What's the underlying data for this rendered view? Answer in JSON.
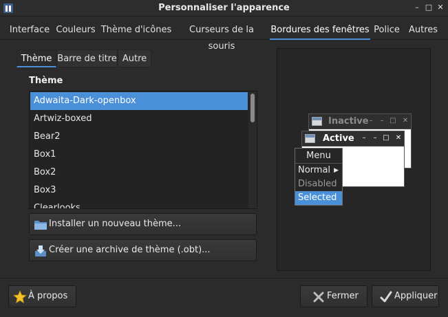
{
  "window": {
    "title": "Personnaliser l'apparence",
    "controls": [
      "minimize",
      "maximize",
      "close"
    ]
  },
  "tabs": [
    {
      "label": "Interface",
      "active": false
    },
    {
      "label": "Couleurs",
      "active": false
    },
    {
      "label": "Thème d'icônes",
      "active": false
    },
    {
      "label": "Curseurs de la souris",
      "active": false
    },
    {
      "label": "Bordures des fenêtres",
      "active": true
    },
    {
      "label": "Police",
      "active": false
    },
    {
      "label": "Autres",
      "active": false
    }
  ],
  "subtabs": [
    {
      "label": "Thème",
      "active": true
    },
    {
      "label": "Barre de titre",
      "active": false
    },
    {
      "label": "Autre",
      "active": false
    }
  ],
  "theme_section": {
    "label": "Thème",
    "items": [
      "Adwaita-Dark-openbox",
      "Artwiz-boxed",
      "Bear2",
      "Box1",
      "Box2",
      "Box3",
      "Clearlooks"
    ],
    "selected": "Adwaita-Dark-openbox"
  },
  "buttons": {
    "install": "Installer un nouveau thème...",
    "archive": "Créer une archive de thème (.obt)...",
    "about": "À propos",
    "close": "Fermer",
    "apply": "Appliquer"
  },
  "preview": {
    "inactive_title": "Inactive",
    "active_title": "Active",
    "menu_title": "Menu",
    "menu_items": [
      {
        "label": "Normal",
        "state": "normal",
        "submenu": true
      },
      {
        "label": "Disabled",
        "state": "disabled",
        "submenu": false
      },
      {
        "label": "Selected",
        "state": "selected",
        "submenu": false
      }
    ]
  },
  "colors": {
    "accent": "#4a90d9",
    "background": "#2b2b2b"
  }
}
